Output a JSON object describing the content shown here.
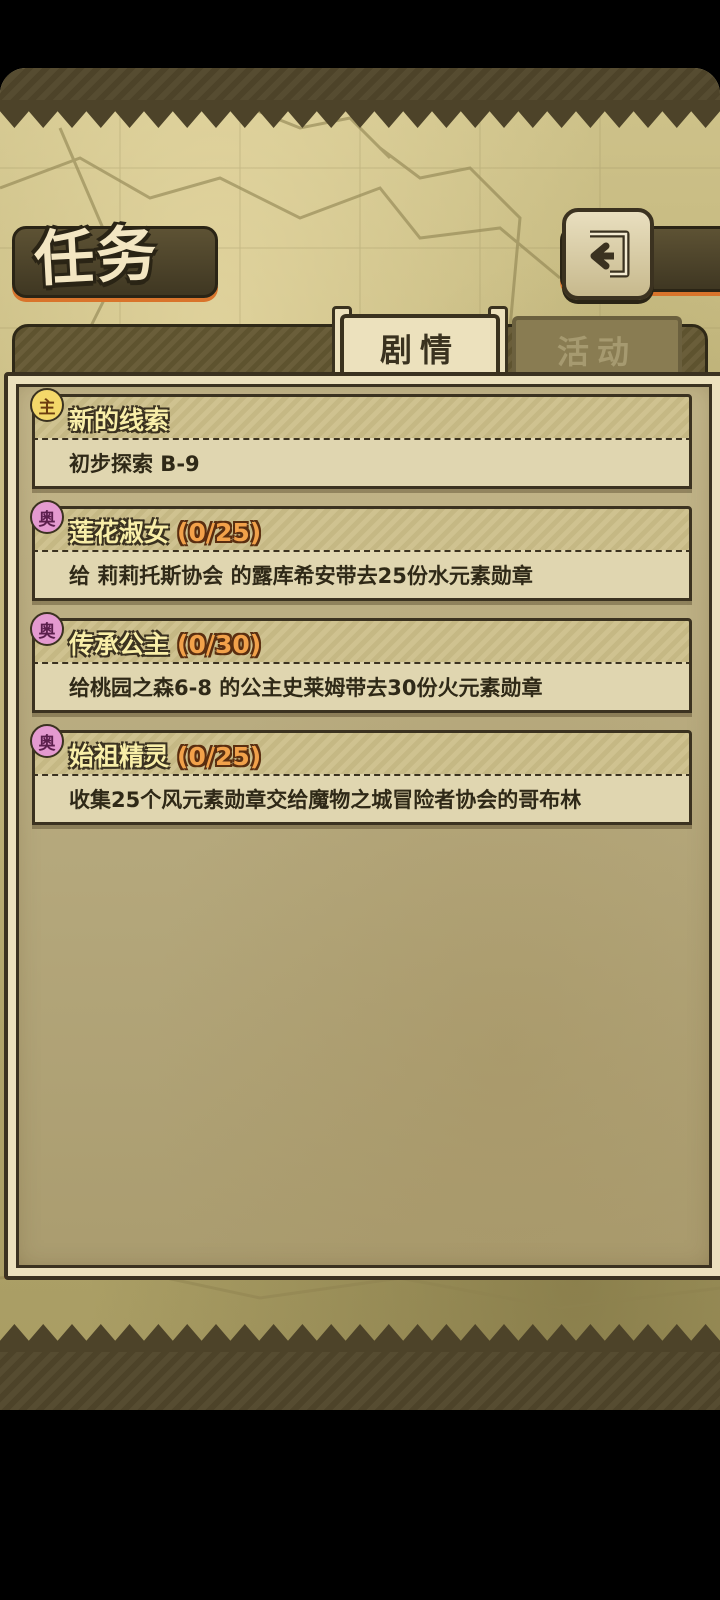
{
  "header": {
    "title": "任务",
    "back_icon": "return-arrow-icon"
  },
  "tabs": [
    {
      "label": "剧情",
      "active": true
    },
    {
      "label": "活动",
      "active": false
    }
  ],
  "quests": [
    {
      "badge": "主",
      "badge_type": "main",
      "title": "新的线索",
      "progress": "",
      "description": "初步探索 B-9"
    },
    {
      "badge": "奥",
      "badge_type": "side",
      "title": "莲花淑女",
      "progress": "(0/25)",
      "description": "给 莉莉托斯协会 的露库希安带去25份水元素勋章"
    },
    {
      "badge": "奥",
      "badge_type": "side",
      "title": "传承公主",
      "progress": "(0/30)",
      "description": "给桃园之森6-8 的公主史莱姆带去30份火元素勋章"
    },
    {
      "badge": "奥",
      "badge_type": "side",
      "title": "始祖精灵",
      "progress": "(0/25)",
      "description": "收集25个风元素勋章交给魔物之城冒险者协会的哥布林"
    }
  ],
  "colors": {
    "accent_orange": "#d9742b",
    "frame_dark": "#3b3220",
    "title_yellow": "#f8eea8",
    "progress_orange": "#f2a14a"
  }
}
